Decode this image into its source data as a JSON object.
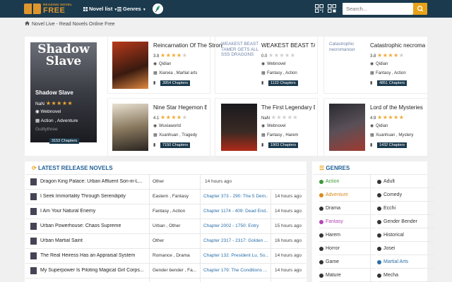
{
  "header": {
    "logo_line1": "READING NOVEL",
    "logo_line2": "FREE",
    "nav_novel_list": "Novel list",
    "nav_genres": "Genres",
    "search_placeholder": "Search...",
    "colors": {
      "bar": "#1b3a4e",
      "accent": "#e8a318"
    }
  },
  "breadcrumb": {
    "text": "Novel Live - Read Novels Online Free"
  },
  "hero": {
    "cover_text": "Shadow Slave",
    "title": "Shadow Slave",
    "rating_label": "NaN",
    "source": "Webnovel",
    "genres": "Action , Adventure",
    "author": "Guiltythree",
    "chapters": "3153 Chapters"
  },
  "cards": [
    {
      "title": "Reincarnation Of The Strongest Sword God",
      "rating": "3.8",
      "stars": 3.5,
      "source": "Qidian",
      "genres": "Xianxia , Martial arts",
      "chapters": "3954 Chapters",
      "cover_alt": ""
    },
    {
      "title": "WEAKEST BEAST TAMER GETS ALL SSS DRAGONS",
      "rating": "0.0",
      "stars": 0,
      "source": "Webnovel",
      "genres": "Fantasy , Action",
      "chapters": "1122 Chapters",
      "cover_alt": "WEAKEST BEAST TAMER GETS ALL SSS DRAGONS"
    },
    {
      "title": "Catastrophic necromancer",
      "rating": "3.8",
      "stars": 3.5,
      "source": "Qidian",
      "genres": "Fantasy , Action",
      "chapters": "4851 Chapters",
      "cover_alt": "Catastrophic necromancer"
    },
    {
      "title": "Nine Star Hegemon Body Art",
      "rating": "4.1",
      "stars": 4,
      "source": "Wuxiaworld",
      "genres": "Xuanhuan , Tragedy",
      "chapters": "7150 Chapters",
      "cover_alt": ""
    },
    {
      "title": "The First Legendary Beast Master",
      "rating": "NaN",
      "stars": 0,
      "source": "Webnovel",
      "genres": "Fantasy , Harem",
      "chapters": "1903 Chapters",
      "cover_alt": ""
    },
    {
      "title": "Lord of the Mysteries",
      "rating": "4.9",
      "stars": 5,
      "source": "Qidian",
      "genres": "Xuanhuan , Mystery",
      "chapters": "1432 Chapters",
      "cover_alt": ""
    }
  ],
  "latest": {
    "heading": "LATEST RELEASE NOVELS",
    "rows": [
      {
        "name": "Dragon King Palace: Urban Affluent Son-in-L...",
        "cat": "Other",
        "chap": "",
        "time": "14 hours ago"
      },
      {
        "name": "I Seek Immortality Through Serendipity",
        "cat": "Eastern , Fantasy",
        "chap": "Chapter 373 - 290: The 5 Dem...",
        "time": "14 hours ago"
      },
      {
        "name": "I Am Your Natural Enemy",
        "cat": "Fantasy , Action",
        "chap": "Chapter 1174 - 409: Dead End...",
        "time": "14 hours ago"
      },
      {
        "name": "Urban Powerhouse: Chaos Supreme",
        "cat": "Urban , Other",
        "chap": "Chapter 2002 - 1750: Entry",
        "time": "15 hours ago"
      },
      {
        "name": "Urban Martial Saint",
        "cat": "Other",
        "chap": "Chapter 2317 - 2317: Golden ...",
        "time": "16 hours ago"
      },
      {
        "name": "The Real Heiress Has an Appraisal System",
        "cat": "Romance , Drama",
        "chap": "Chapter 132: President Lu, So...",
        "time": "14 hours ago"
      },
      {
        "name": "My Superpower Is Piloting Magical Girl Corps...",
        "cat": "Gender bender , Fa...",
        "chap": "Chapter 179: The Conditions ...",
        "time": "14 hours ago"
      }
    ]
  },
  "genres": {
    "heading": "GENRES",
    "items": [
      {
        "label": "Action",
        "color": "#3a9a3a"
      },
      {
        "label": "Adult",
        "color": "#333333"
      },
      {
        "label": "Adventure",
        "color": "#d98a1c"
      },
      {
        "label": "Comedy",
        "color": "#333333"
      },
      {
        "label": "Drama",
        "color": "#333333"
      },
      {
        "label": "Ecchi",
        "color": "#333333"
      },
      {
        "label": "Fantasy",
        "color": "#b544b5"
      },
      {
        "label": "Gender Bender",
        "color": "#333333"
      },
      {
        "label": "Harem",
        "color": "#333333"
      },
      {
        "label": "Historical",
        "color": "#333333"
      },
      {
        "label": "Horror",
        "color": "#333333"
      },
      {
        "label": "Josei",
        "color": "#333333"
      },
      {
        "label": "Game",
        "color": "#333333"
      },
      {
        "label": "Martial Arts",
        "color": "#2a6fa8"
      },
      {
        "label": "Mature",
        "color": "#333333"
      },
      {
        "label": "Mecha",
        "color": "#333333"
      }
    ]
  }
}
